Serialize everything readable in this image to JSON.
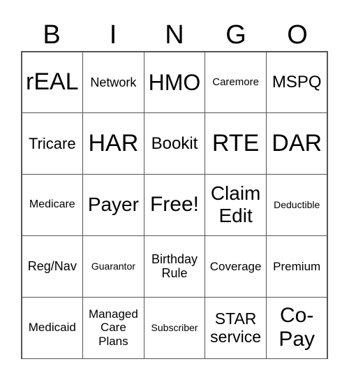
{
  "header": [
    "B",
    "I",
    "N",
    "G",
    "O"
  ],
  "cells": [
    "rEAL",
    "Network",
    "HMO",
    "Caremore",
    "MSPQ",
    "Tricare",
    "HAR",
    "Bookit",
    "RTE",
    "DAR",
    "Medicare",
    "Payer",
    "Free!",
    "Claim\nEdit",
    "Deductible",
    "Reg/Nav",
    "Guarantor",
    "Birthday\nRule",
    "Coverage",
    "Premium",
    "Medicaid",
    "Managed\nCare\nPlans",
    "Subscriber",
    "STAR\nservice",
    "Co-\nPay"
  ]
}
